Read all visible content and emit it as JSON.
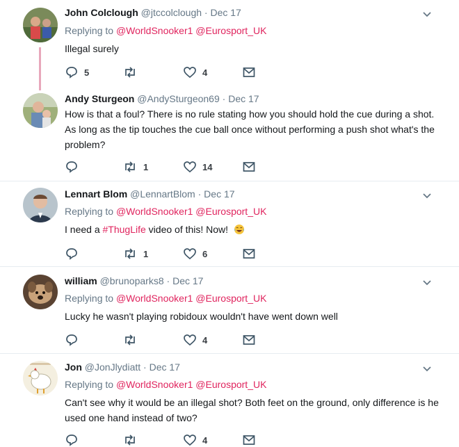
{
  "colors": {
    "mention": "#e0245e",
    "meta": "#657786",
    "thread_line": "#e8a7bb"
  },
  "tweets": [
    {
      "name": "John Colclough",
      "handle": "@jtccolclough",
      "sep": "·",
      "date": "Dec 17",
      "replying": "Replying to",
      "mention1": "@WorldSnooker1",
      "mention2": "@Eurosport_UK",
      "text": "Illegal surely",
      "reply_count": "5",
      "retweet_count": "",
      "like_count": "4"
    },
    {
      "name": "Andy Sturgeon",
      "handle": "@AndySturgeon69",
      "sep": "·",
      "date": "Dec 17",
      "text": "How is that a foul? There is no rule stating how you should hold the cue during a shot. As long as the tip touches the cue ball once without performing a push shot what's the problem?",
      "reply_count": "",
      "retweet_count": "1",
      "like_count": "14"
    },
    {
      "name": "Lennart Blom",
      "handle": "@LennartBlom",
      "sep": "·",
      "date": "Dec 17",
      "replying": "Replying to",
      "mention1": "@WorldSnooker1",
      "mention2": "@Eurosport_UK",
      "text_pre": "I need a ",
      "hashtag": "#ThugLife",
      "text_post": " video of this! Now!",
      "emoji": "tears-of-joy-emoji",
      "reply_count": "",
      "retweet_count": "1",
      "like_count": "6"
    },
    {
      "name": "william",
      "handle": "@brunoparks8",
      "sep": "·",
      "date": "Dec 17",
      "replying": "Replying to",
      "mention1": "@WorldSnooker1",
      "mention2": "@Eurosport_UK",
      "text": "Lucky he wasn't playing robidoux wouldn't have went down well",
      "reply_count": "",
      "retweet_count": "",
      "like_count": "4"
    },
    {
      "name": "Jon",
      "handle": "@JonJlydiatt",
      "sep": "·",
      "date": "Dec 17",
      "replying": "Replying to",
      "mention1": "@WorldSnooker1",
      "mention2": "@Eurosport_UK",
      "text": "Can't see why it would be an illegal shot? Both feet on the ground, only difference is he used one hand instead of two?",
      "reply_count": "",
      "retweet_count": "",
      "like_count": "4"
    }
  ]
}
